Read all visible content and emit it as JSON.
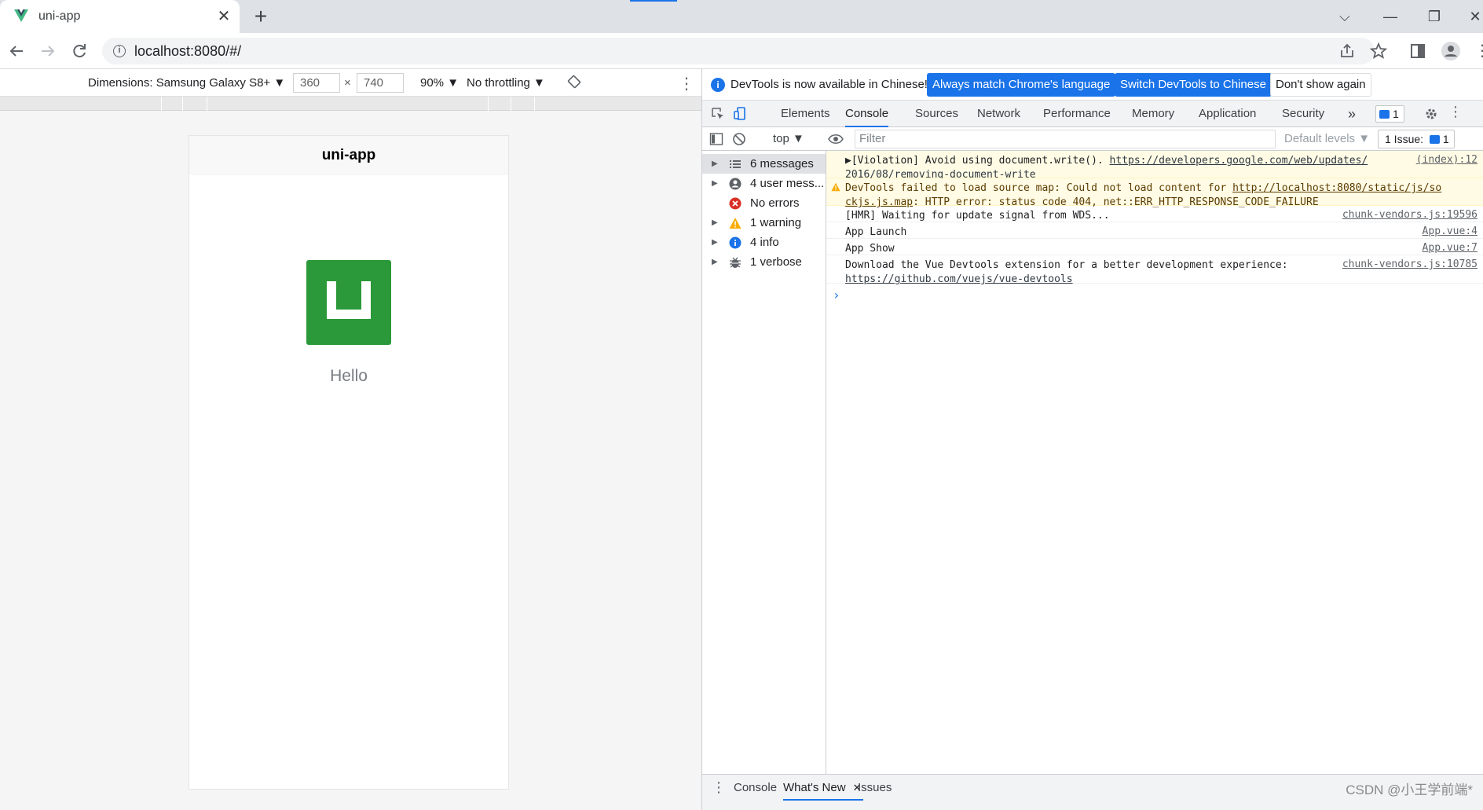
{
  "browser": {
    "tab": {
      "title": "uni-app",
      "close": "✕",
      "favicon": "vue-logo-icon"
    },
    "new_tab": "+",
    "window_controls": {
      "dropdown": "⌵",
      "minimize": "—",
      "restore": "❐",
      "close": "✕"
    },
    "url": "localhost:8080/#/",
    "accent": "#1a73e8"
  },
  "device_toolbar": {
    "dimensions_label": "Dimensions: Samsung Galaxy S8+ ▼",
    "width": "360",
    "times": "×",
    "height": "740",
    "zoom": "90% ▼",
    "throttling": "No throttling ▼"
  },
  "app": {
    "navbar_title": "uni-app",
    "hello": "Hello",
    "logo_color": "#2b9939"
  },
  "devtools": {
    "infobar": {
      "message": "DevTools is now available in Chinese!",
      "btn_match": "Always match Chrome's language",
      "btn_switch": "Switch DevTools to Chinese",
      "btn_dismiss": "Don't show again"
    },
    "tabs": [
      "Elements",
      "Console",
      "Sources",
      "Network",
      "Performance",
      "Memory",
      "Application",
      "Security"
    ],
    "more_tabs": "»",
    "messages_badge": "1",
    "console_toolbar": {
      "context": "top ▼",
      "filter_placeholder": "Filter",
      "levels": "Default levels ▼",
      "issues_label": "1 Issue:",
      "issues_count": "1"
    },
    "sidebar": [
      {
        "label": "6 messages",
        "icon": "list-icon"
      },
      {
        "label": "4 user mess...",
        "icon": "user-icon"
      },
      {
        "label": "No errors",
        "icon": "error-icon"
      },
      {
        "label": "1 warning",
        "icon": "warning-icon"
      },
      {
        "label": "4 info",
        "icon": "info-icon"
      },
      {
        "label": "1 verbose",
        "icon": "bug-icon"
      }
    ],
    "log": {
      "violation_prefix": "▶[Violation] Avoid using document.write(). ",
      "violation_link": "https://developers.google.com/web/updates/",
      "violation_link2": "2016/08/removing-document-write",
      "violation_src": "(index):12",
      "warn_prefix": "DevTools failed to load source map: Could not load content for ",
      "warn_link": "http://localhost:8080/static/js/so",
      "warn_link2": "ckjs.js.map",
      "warn_suffix": ": HTTP error: status code 404, net::ERR_HTTP_RESPONSE_CODE_FAILURE",
      "hmr": "[HMR] Waiting for update signal from WDS...",
      "hmr_src": "chunk-vendors.js:19596",
      "launch": "App Launch",
      "launch_src": "App.vue:4",
      "show": "App Show",
      "show_src": "App.vue:7",
      "devtools_msg": "Download the Vue Devtools extension for a better development experience:",
      "devtools_link": "https://github.com/vuejs/vue-devtools",
      "devtools_src": "chunk-vendors.js:10785",
      "prompt": "›"
    },
    "drawer": {
      "tab_console": "Console",
      "tab_whatsnew": "What's New",
      "whatsnew_close": "✕",
      "tab_issues": "Issues"
    }
  },
  "watermark": "CSDN @小王学前端*"
}
